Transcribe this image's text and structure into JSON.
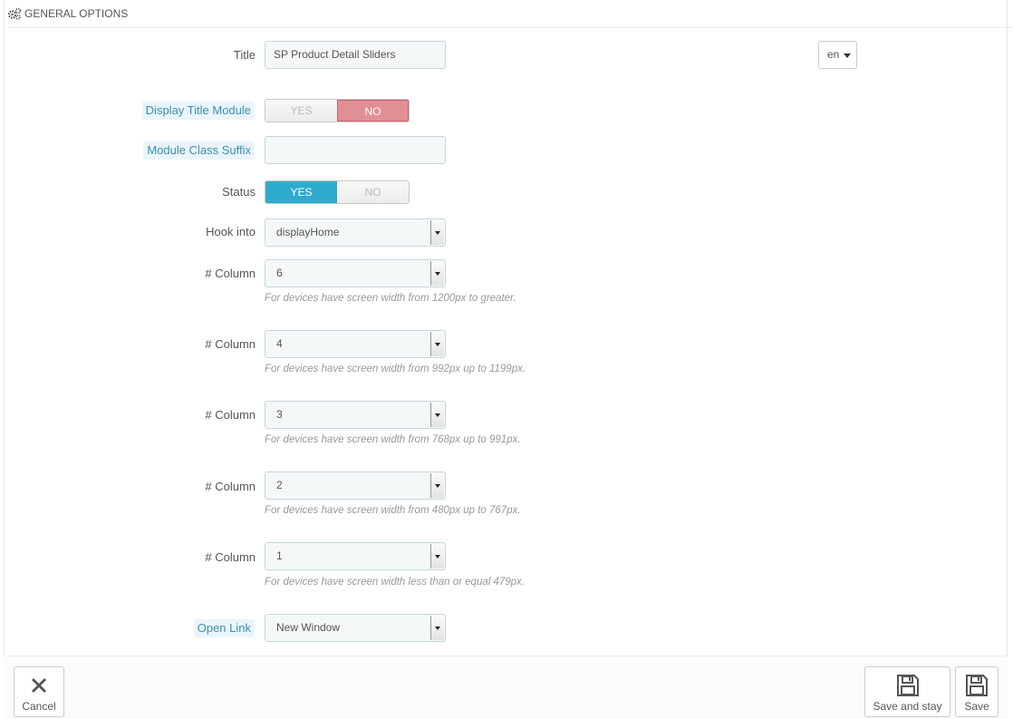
{
  "panel": {
    "heading": "General options",
    "heading_icon": "cogs-icon"
  },
  "title_field": {
    "label": "Title",
    "value": "SP Product Detail Sliders",
    "lang": "en"
  },
  "display_title": {
    "label": "Display Title Module",
    "yes": "YES",
    "no": "NO",
    "selected": "NO"
  },
  "class_suffix": {
    "label": "Module Class Suffix",
    "value": ""
  },
  "status": {
    "label": "Status",
    "yes": "YES",
    "no": "NO",
    "selected": "YES"
  },
  "hook": {
    "label": "Hook into",
    "value": "displayHome"
  },
  "columns": [
    {
      "label": "# Column",
      "value": "6",
      "help": "For devices have screen width from 1200px to greater."
    },
    {
      "label": "# Column",
      "value": "4",
      "help": "For devices have screen width from 992px up to 1199px."
    },
    {
      "label": "# Column",
      "value": "3",
      "help": "For devices have screen width from 768px up to 991px."
    },
    {
      "label": "# Column",
      "value": "2",
      "help": "For devices have screen width from 480px up to 767px."
    },
    {
      "label": "# Column",
      "value": "1",
      "help": "For devices have screen width less than or equal 479px."
    }
  ],
  "open_link": {
    "label": "Open Link",
    "value": "New Window"
  },
  "footer": {
    "cancel": "Cancel",
    "save_and_stay": "Save and stay",
    "save": "Save"
  },
  "colors": {
    "accent": "#2eacce",
    "no_selected": "#e08f95",
    "hint_text": "#3d8fb5"
  }
}
